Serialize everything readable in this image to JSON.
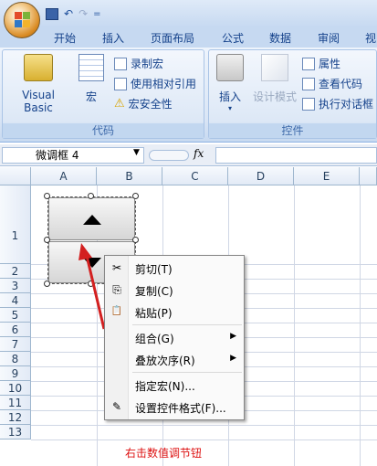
{
  "quick_access": {
    "undo_label": "↶",
    "redo_label": "↷",
    "customize_label": "="
  },
  "tabs": [
    "开始",
    "插入",
    "页面布局",
    "公式",
    "数据",
    "审阅",
    "视"
  ],
  "ribbon": {
    "code_group": {
      "label": "代码",
      "visual_basic_label": "Visual Basic",
      "macro_label": "宏",
      "record_macro_label": "录制宏",
      "relative_ref_label": "使用相对引用",
      "macro_security_label": "宏安全性"
    },
    "controls_group": {
      "label": "控件",
      "insert_label": "插入",
      "design_mode_label": "设计模式",
      "properties_label": "属性",
      "view_code_label": "查看代码",
      "run_dialog_label": "执行对话框"
    }
  },
  "formula_bar": {
    "name_box_value": "微调框 4",
    "fx_label": "fx",
    "formula_value": ""
  },
  "grid": {
    "columns": [
      "A",
      "B",
      "C",
      "D",
      "E"
    ],
    "rows": [
      "1",
      "2",
      "3",
      "4",
      "5",
      "6",
      "7",
      "8",
      "9",
      "10",
      "11",
      "12",
      "13"
    ]
  },
  "context_menu": {
    "items": [
      {
        "label": "剪切(T)",
        "icon": "✂"
      },
      {
        "label": "复制(C)",
        "icon": "⎘"
      },
      {
        "label": "粘贴(P)",
        "icon": "📋"
      },
      {
        "label": "组合(G)",
        "submenu": true
      },
      {
        "label": "叠放次序(R)",
        "submenu": true
      },
      {
        "label": "指定宏(N)..."
      },
      {
        "label": "设置控件格式(F)...",
        "icon": "✎"
      }
    ]
  },
  "annotation": {
    "caption": "右击数值调节钮",
    "arrow_color": "#d32020"
  },
  "colors": {
    "ribbon_bg": "#dae6f6",
    "accent": "#15428b",
    "caption": "#dd1111"
  }
}
